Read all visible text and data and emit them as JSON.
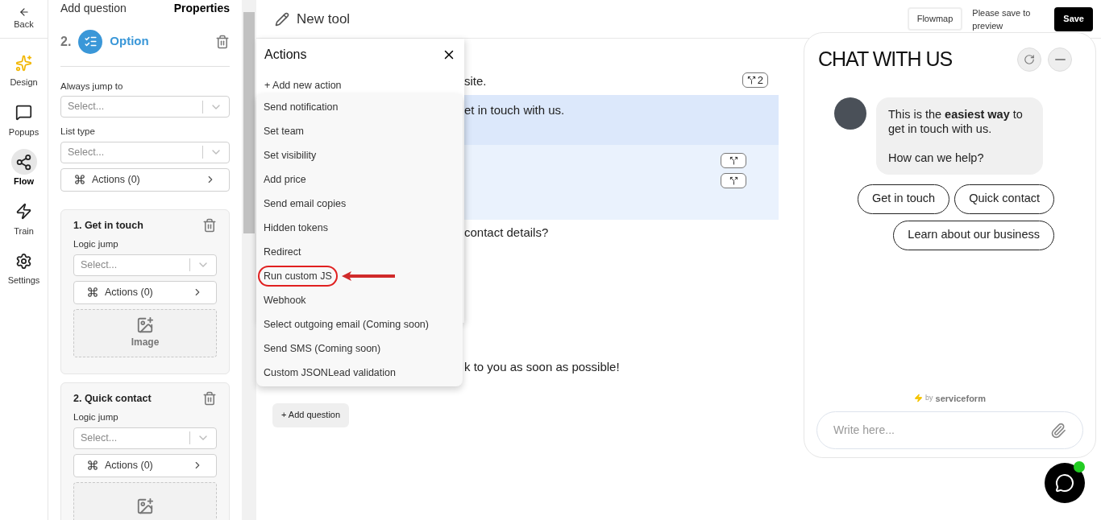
{
  "nav": {
    "back": "Back",
    "items": [
      {
        "kind": "design",
        "label": "Design",
        "selected": false
      },
      {
        "kind": "popups",
        "label": "Popups",
        "selected": false
      },
      {
        "kind": "flow",
        "label": "Flow",
        "selected": true
      },
      {
        "kind": "train",
        "label": "Train",
        "selected": false
      },
      {
        "kind": "settings",
        "label": "Settings",
        "selected": false
      }
    ]
  },
  "panel": {
    "tabs": [
      {
        "label": "Add question",
        "selected": false
      },
      {
        "label": "Properties",
        "selected": true
      }
    ],
    "question": {
      "number": "2.",
      "title": "Option"
    },
    "fields": [
      {
        "label": "Always jump to",
        "placeholder": "Select..."
      },
      {
        "label": "List type",
        "placeholder": "Select..."
      }
    ],
    "actions": "Actions (0)",
    "cards": [
      {
        "title": "1. Get in touch",
        "label": "Logic jump",
        "placeholder": "Select...",
        "actions": "Actions (0)",
        "image": "Image"
      },
      {
        "title": "2. Quick contact",
        "label": "Logic jump",
        "placeholder": "Select...",
        "actions": "Actions (0)"
      }
    ]
  },
  "header": {
    "title": "New tool",
    "flowmap": "Flowmap",
    "note": "Please save to preview",
    "save": "Save"
  },
  "canvas": {
    "rows": [
      {
        "text": "site.",
        "badges": [
          {
            "kind": "branch",
            "count": "2"
          }
        ],
        "selected": false,
        "highlighted": false
      },
      {
        "text": "et in touch with us.",
        "selected": true,
        "highlighted": false
      },
      {
        "badges": [
          {
            "kind": "branch"
          },
          {
            "kind": "branch"
          }
        ],
        "selected": false,
        "highlighted": true
      },
      {
        "text": "contact details?",
        "selected": false,
        "highlighted": false
      },
      {
        "text": "k to you as soon as possible!",
        "selected": false,
        "highlighted": false
      }
    ],
    "add_question": "+ Add question"
  },
  "actions_popup": {
    "title": "Actions",
    "add": "+ Add new action",
    "items": [
      {
        "label": "Send notification",
        "annotated": false
      },
      {
        "label": "Set team",
        "annotated": false
      },
      {
        "label": "Set visibility",
        "annotated": false
      },
      {
        "label": "Add price",
        "annotated": false
      },
      {
        "label": "Send email copies",
        "annotated": false
      },
      {
        "label": "Hidden tokens",
        "annotated": false
      },
      {
        "label": "Redirect",
        "annotated": false
      },
      {
        "label": "Run custom JS",
        "annotated": true
      },
      {
        "label": "Webhook",
        "annotated": false
      },
      {
        "label": "Select outgoing email (Coming soon)",
        "annotated": false
      },
      {
        "label": "Send SMS (Coming soon)",
        "annotated": false
      },
      {
        "label": "Custom JSONLead validation",
        "annotated": false
      }
    ]
  },
  "chat": {
    "title": "CHAT WITH US",
    "message": [
      "This is the **easiest way** to get in touch with us.",
      "How can we help?"
    ],
    "options": [
      "Get in touch",
      "Quick contact",
      "Learn about our business"
    ],
    "by": "by",
    "brand": "serviceform",
    "placeholder": "Write here...",
    "online": true
  }
}
